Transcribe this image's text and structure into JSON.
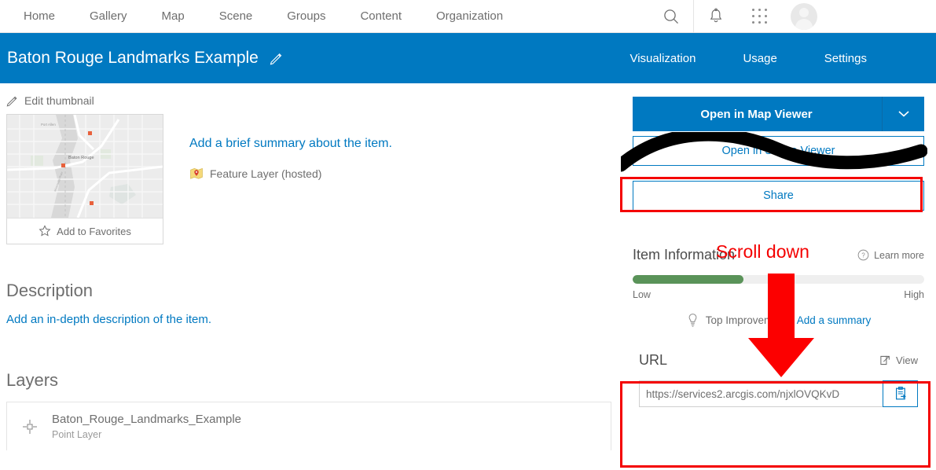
{
  "topnav": {
    "links": [
      {
        "label": "Home",
        "name": "nav-home"
      },
      {
        "label": "Gallery",
        "name": "nav-gallery"
      },
      {
        "label": "Map",
        "name": "nav-map"
      },
      {
        "label": "Scene",
        "name": "nav-scene"
      },
      {
        "label": "Groups",
        "name": "nav-groups"
      },
      {
        "label": "Content",
        "name": "nav-content"
      },
      {
        "label": "Organization",
        "name": "nav-organization"
      }
    ],
    "icons": {
      "search": "search-icon",
      "notifications": "bell-icon",
      "app_launcher": "grid-apps-icon",
      "avatar": "user-avatar"
    }
  },
  "item_header": {
    "title": "Baton Rouge Landmarks Example",
    "edit_icon": "pencil-icon",
    "tabs": [
      {
        "label": "Visualization",
        "name": "tab-visualization"
      },
      {
        "label": "Usage",
        "name": "tab-usage"
      },
      {
        "label": "Settings",
        "name": "tab-settings"
      }
    ],
    "background_color": "#0079c1"
  },
  "left": {
    "edit_thumbnail_label": "Edit thumbnail",
    "edit_thumbnail_icon": "pencil-icon",
    "add_to_favorites_label": "Add to Favorites",
    "favorites_icon": "star-icon",
    "summary_link": "Add a brief summary about the item.",
    "item_type": "Feature Layer (hosted)",
    "item_type_icon": "feature-layer-icon",
    "description_title": "Description",
    "description_link": "Add an in-depth description of the item.",
    "layers_title": "Layers",
    "layers": [
      {
        "name": "Baton_Rouge_Landmarks_Example",
        "type": "Point Layer",
        "icon": "point-layer-icon"
      }
    ]
  },
  "right": {
    "open_map_viewer_label": "Open in Map Viewer",
    "open_map_viewer_caret": "chevron-down-icon",
    "open_scene_viewer_label": "Open in Scene Viewer",
    "open_scene_viewer_visible_fragment": "Viewer",
    "share_label": "Share",
    "item_information": {
      "title": "Item Information",
      "learn_more_label": "Learn more",
      "learn_more_icon": "question-circle-icon",
      "progress_percent": 38,
      "progress_color": "#5a9359",
      "low_label": "Low",
      "high_label": "High",
      "top_improvement_label": "Top Improvement:",
      "top_improvement_icon": "lightbulb-icon",
      "add_summary_link": "Add a summary"
    },
    "url": {
      "label": "URL",
      "view_label": "View",
      "view_icon": "external-link-icon",
      "value": "https://services2.arcgis.com/njxlOVQKvD",
      "copy_icon": "clipboard-copy-icon"
    }
  },
  "annotations": {
    "scroll_down_text": "Scroll down",
    "color": "#f40000",
    "arrow_name": "red-down-arrow",
    "redaction_name": "black-scribble-redaction",
    "share_highlight_name": "share-highlight-box",
    "url_highlight_name": "url-highlight-box"
  }
}
